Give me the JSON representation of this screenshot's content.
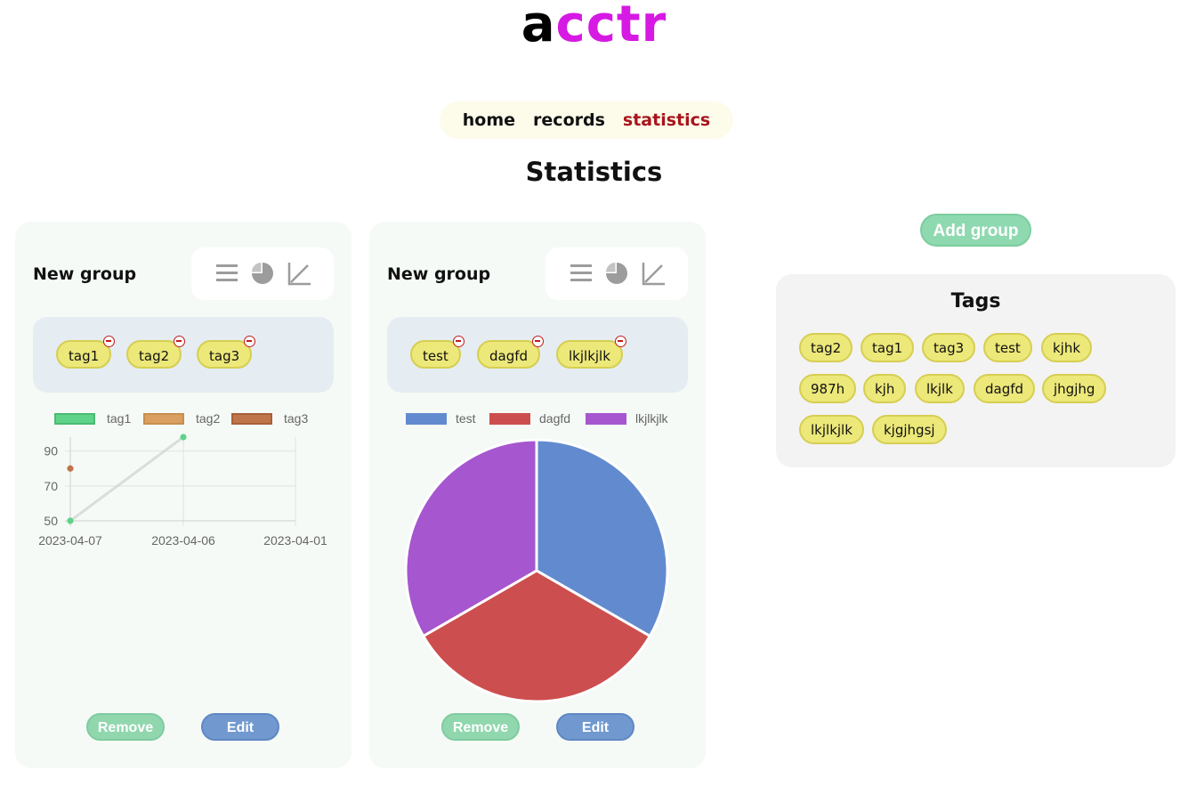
{
  "logo": {
    "first": "a",
    "rest": "cctr"
  },
  "nav": {
    "items": [
      "home",
      "records",
      "statistics"
    ],
    "active": "statistics"
  },
  "page": {
    "title": "Statistics"
  },
  "colors": {
    "accent": "#d619e3",
    "nav_active": "#a8151c",
    "tag_chip": "#ece879",
    "remove_button": "#91d7ae",
    "edit_button": "#7199d0"
  },
  "view_icons": [
    "list-icon",
    "pie-icon",
    "line-chart-icon"
  ],
  "groups": [
    {
      "title": "New group",
      "tags": [
        "tag1",
        "tag2",
        "tag3"
      ],
      "remove_label": "Remove",
      "edit_label": "Edit",
      "chart_data": {
        "type": "line",
        "x": [
          "2023-04-07",
          "2023-04-06",
          "2023-04-01"
        ],
        "xticks": [
          "2023-04-07",
          "2023-04-06",
          "2023-04-01"
        ],
        "yticks": [
          50,
          70,
          90
        ],
        "ylim": [
          50,
          98
        ],
        "grid": true,
        "legend": "top",
        "series": [
          {
            "name": "tag1",
            "values": [
              50,
              98,
              null
            ],
            "color": "#5fd389"
          },
          {
            "name": "tag2",
            "values": [
              null,
              null,
              null
            ],
            "color": "#d9a062"
          },
          {
            "name": "tag3",
            "values": [
              80,
              null,
              null
            ],
            "color": "#c0744a"
          }
        ]
      }
    },
    {
      "title": "New group",
      "tags": [
        "test",
        "dagfd",
        "lkjlkjlk"
      ],
      "remove_label": "Remove",
      "edit_label": "Edit",
      "chart_data": {
        "type": "pie",
        "legend": "top",
        "slices": [
          {
            "name": "test",
            "value": 1,
            "color": "#628bcf"
          },
          {
            "name": "dagfd",
            "value": 1,
            "color": "#cd4e4e"
          },
          {
            "name": "lkjlkjlk",
            "value": 1,
            "color": "#a656cf"
          }
        ]
      }
    }
  ],
  "add_group_label": "Add group",
  "tags_panel": {
    "title": "Tags",
    "tags": [
      "tag2",
      "tag1",
      "tag3",
      "test",
      "kjhk",
      "987h",
      "kjh",
      "lkjlk",
      "dagfd",
      "jhgjhg",
      "lkjlkjlk",
      "kjgjhgsj"
    ]
  }
}
